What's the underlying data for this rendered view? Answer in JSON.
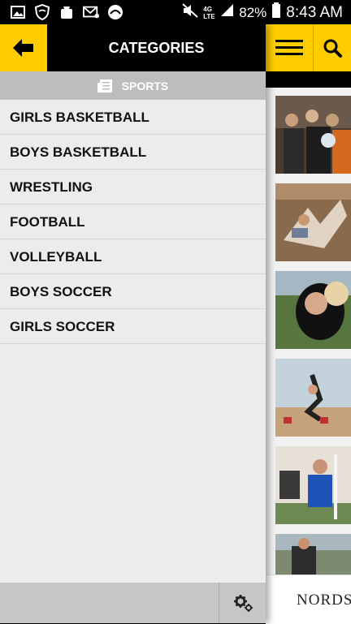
{
  "status_bar": {
    "battery": "82%",
    "time": "8:43 AM",
    "network": "4G LTE"
  },
  "drawer": {
    "title": "CATEGORIES",
    "section": "SPORTS",
    "items": [
      {
        "label": "GIRLS BASKETBALL"
      },
      {
        "label": "BOYS BASKETBALL"
      },
      {
        "label": "WRESTLING"
      },
      {
        "label": "FOOTBALL"
      },
      {
        "label": "VOLLEYBALL"
      },
      {
        "label": "BOYS SOCCER"
      },
      {
        "label": "GIRLS SOCCER"
      }
    ]
  },
  "background_page": {
    "footer_text": "NORDS"
  },
  "colors": {
    "accent": "#ffcc00",
    "header": "#000000",
    "section_bar": "#bdbdbd",
    "drawer_bg": "#ececec"
  },
  "icons": [
    "back-arrow-icon",
    "newspaper-icon",
    "settings-gears-icon",
    "hamburger-icon",
    "search-icon"
  ]
}
